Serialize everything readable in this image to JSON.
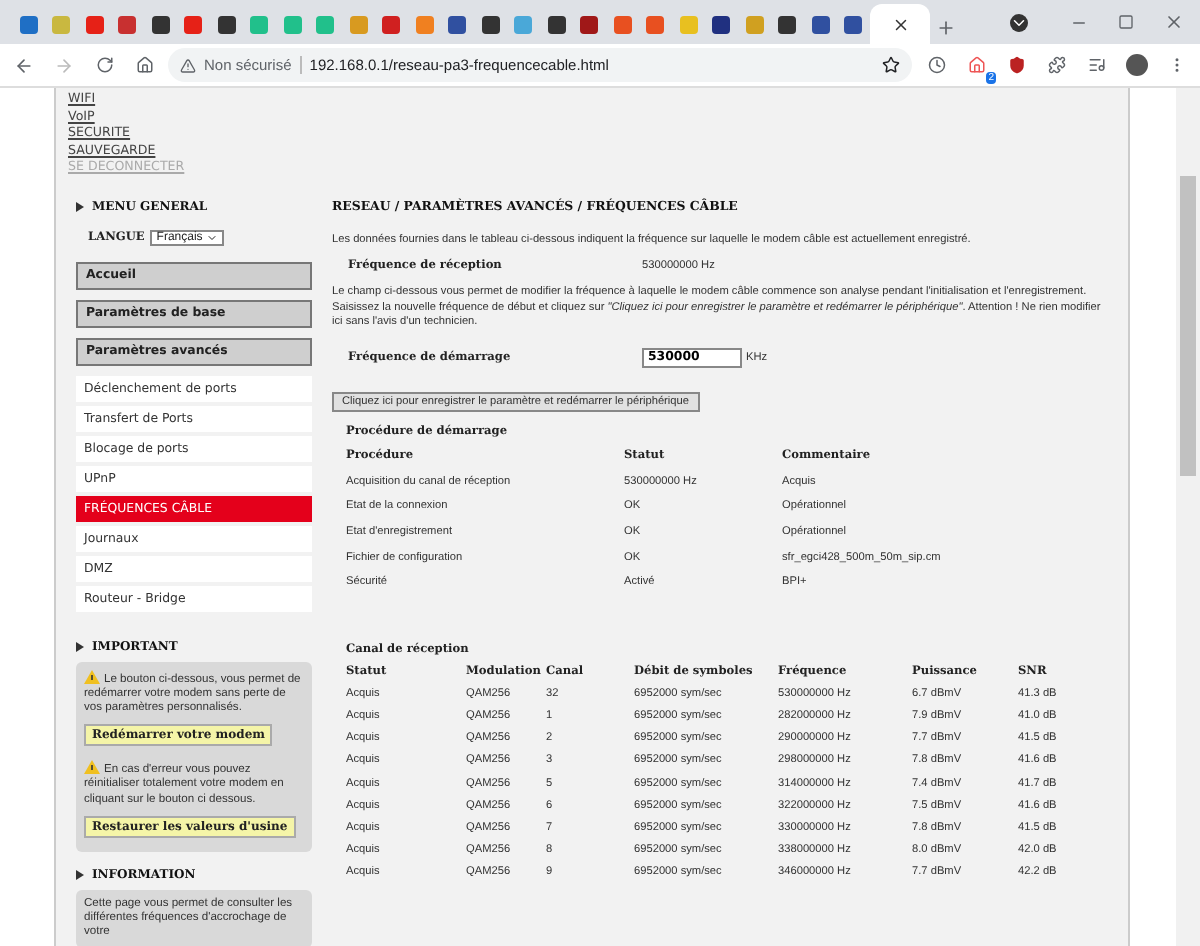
{
  "browser": {
    "tabs": [
      {
        "color": "#1f6fc5",
        "selected": false
      },
      {
        "color": "#c9b840",
        "selected": false
      },
      {
        "color": "#e62117",
        "selected": false
      },
      {
        "color": "#c83030",
        "selected": false
      },
      {
        "color": "#333333",
        "selected": false
      },
      {
        "color": "#e62117",
        "selected": false
      },
      {
        "color": "#333333",
        "selected": false
      },
      {
        "color": "#21c08b",
        "selected": false
      },
      {
        "color": "#21c08b",
        "selected": false
      },
      {
        "color": "#21c08b",
        "selected": false
      },
      {
        "color": "#d89a20",
        "selected": false
      },
      {
        "color": "#d02020",
        "selected": false
      },
      {
        "color": "#f08020",
        "selected": false
      },
      {
        "color": "#3050a0",
        "selected": false
      },
      {
        "color": "#333333",
        "selected": false
      },
      {
        "color": "#4aa8d8",
        "selected": false
      },
      {
        "color": "#333333",
        "selected": false
      },
      {
        "color": "#a01818",
        "selected": false
      },
      {
        "color": "#e85020",
        "selected": false
      },
      {
        "color": "#e85020",
        "selected": false
      },
      {
        "color": "#e8c020",
        "selected": false
      },
      {
        "color": "#203080",
        "selected": false
      },
      {
        "color": "#d0a020",
        "selected": false
      },
      {
        "color": "#333333",
        "selected": false
      },
      {
        "color": "#3050a0",
        "selected": false
      },
      {
        "color": "#3050a0",
        "selected": false
      },
      {
        "selected": true
      }
    ],
    "security": "Non sécurisé",
    "url": "192.168.0.1/reseau-pa3-frequencecable.html",
    "extension_badge": "2"
  },
  "top_links": [
    {
      "label": "WIFI",
      "disabled": false
    },
    {
      "label": "VoIP",
      "disabled": false
    },
    {
      "label": "SECURITE",
      "disabled": false
    },
    {
      "label": "SAUVEGARDE",
      "disabled": false
    },
    {
      "label": "SE DECONNECTER",
      "disabled": true
    }
  ],
  "sidebar": {
    "menu_title": "MENU GENERAL",
    "language": {
      "label": "LANGUE",
      "value": "Français"
    },
    "items": [
      {
        "kind": "section",
        "label": "Accueil",
        "selected": false
      },
      {
        "kind": "section",
        "label": "Paramètres de base",
        "selected": false
      },
      {
        "kind": "section",
        "label": "Paramètres avancés",
        "selected": false
      },
      {
        "kind": "item",
        "label": "Déclenchement de ports",
        "selected": false
      },
      {
        "kind": "item",
        "label": "Transfert de Ports",
        "selected": false
      },
      {
        "kind": "item",
        "label": "Blocage de ports",
        "selected": false
      },
      {
        "kind": "item",
        "label": "UPnP",
        "selected": false
      },
      {
        "kind": "item",
        "label": "FRÉQUENCES CÂBLE",
        "selected": true
      },
      {
        "kind": "item",
        "label": "Journaux",
        "selected": false
      },
      {
        "kind": "item",
        "label": "DMZ",
        "selected": false
      },
      {
        "kind": "item",
        "label": "Routeur - Bridge",
        "selected": false
      }
    ],
    "important": {
      "title": "IMPORTANT",
      "notes": [
        {
          "text": "Le bouton ci-dessous, vous permet de redémarrer votre modem sans perte de vos paramètres personnalisés.",
          "button": "Redémarrer votre modem"
        },
        {
          "text": "En cas d'erreur vous pouvez réinitialiser totalement votre modem en cliquant sur le bouton ci dessous.",
          "button": "Restaurer les valeurs d'usine"
        }
      ]
    },
    "information": {
      "title": "INFORMATION",
      "text": "Cette page vous permet de consulter les différentes fréquences d'accrochage de votre"
    }
  },
  "main": {
    "title": "RESEAU / PARAMÈTRES AVANCÉS / FRÉQUENCES CÂBLE",
    "intro": "Les données fournies dans le tableau ci-dessous indiquent la fréquence sur laquelle le modem câble est actuellement enregistré.",
    "reception": {
      "label": "Fréquence de réception",
      "value": "530000000 Hz"
    },
    "note": "Le champ ci-dessous vous permet de modifier la fréquence à laquelle le modem câble commence son analyse pendant l'initialisation et l'enregistrement. Saisissez la nouvelle fréquence de début et cliquez sur *\"Cliquez ici pour enregistrer le paramètre et redémarrer le périphérique\"*. Attention ! Ne rien modifier ici sans l'avis d'un technicien.",
    "start_frequency": {
      "label": "Fréquence de démarrage",
      "value": "530000",
      "unit": "KHz"
    },
    "save_button": "Cliquez ici pour enregistrer le paramètre et redémarrer le périphérique",
    "procedure": {
      "title": "Procédure de démarrage",
      "columns": [
        "Procédure",
        "Statut",
        "Commentaire"
      ],
      "rows": [
        [
          "Acquisition du canal de réception",
          "530000000 Hz",
          "Acquis"
        ],
        [
          "Etat de la connexion",
          "OK",
          "Opérationnel"
        ],
        [
          "Etat d'enregistrement",
          "OK",
          "Opérationnel"
        ],
        [
          "Fichier de configuration",
          "OK",
          "sfr_egci428_500m_50m_sip.cm"
        ],
        [
          "Sécurité",
          "Activé",
          "BPI+"
        ]
      ]
    },
    "channels": {
      "title": "Canal de réception",
      "columns": [
        "Statut",
        "Modulation",
        "Canal",
        "Débit de symboles",
        "Fréquence",
        "Puissance",
        "SNR"
      ],
      "rows": [
        [
          "Acquis",
          "QAM256",
          "32",
          "6952000 sym/sec",
          "530000000 Hz",
          "6.7 dBmV",
          "41.3 dB"
        ],
        [
          "Acquis",
          "QAM256",
          "1",
          "6952000 sym/sec",
          "282000000 Hz",
          "7.9 dBmV",
          "41.0 dB"
        ],
        [
          "Acquis",
          "QAM256",
          "2",
          "6952000 sym/sec",
          "290000000 Hz",
          "7.7 dBmV",
          "41.5 dB"
        ],
        [
          "Acquis",
          "QAM256",
          "3",
          "6952000 sym/sec",
          "298000000 Hz",
          "7.8 dBmV",
          "41.6 dB"
        ],
        [
          "Acquis",
          "QAM256",
          "5",
          "6952000 sym/sec",
          "314000000 Hz",
          "7.4 dBmV",
          "41.7 dB"
        ],
        [
          "Acquis",
          "QAM256",
          "6",
          "6952000 sym/sec",
          "322000000 Hz",
          "7.5 dBmV",
          "41.6 dB"
        ],
        [
          "Acquis",
          "QAM256",
          "7",
          "6952000 sym/sec",
          "330000000 Hz",
          "7.8 dBmV",
          "41.5 dB"
        ],
        [
          "Acquis",
          "QAM256",
          "8",
          "6952000 sym/sec",
          "338000000 Hz",
          "8.0 dBmV",
          "42.0 dB"
        ],
        [
          "Acquis",
          "QAM256",
          "9",
          "6952000 sym/sec",
          "346000000 Hz",
          "7.7 dBmV",
          "42.2 dB"
        ]
      ]
    }
  }
}
